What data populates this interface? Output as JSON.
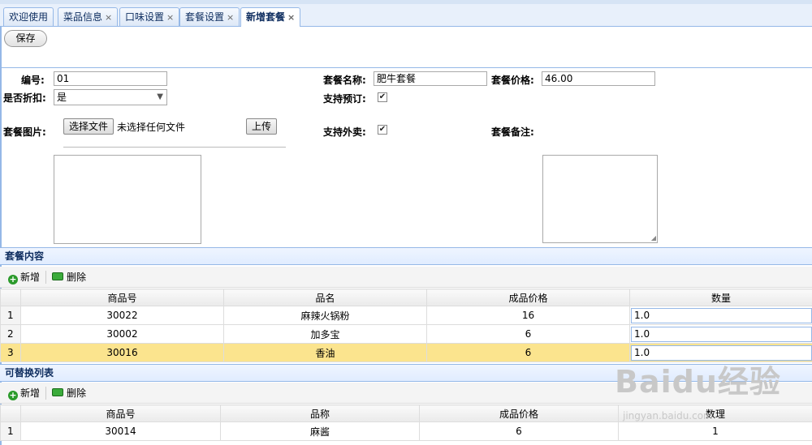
{
  "tabs": [
    {
      "label": "欢迎使用",
      "closable": false
    },
    {
      "label": "菜品信息",
      "closable": true
    },
    {
      "label": "口味设置",
      "closable": true
    },
    {
      "label": "套餐设置",
      "closable": true
    },
    {
      "label": "新增套餐",
      "closable": true,
      "active": true
    }
  ],
  "close_glyph": "×",
  "toolbar": {
    "save_label": "保存"
  },
  "form": {
    "code_label": "编号:",
    "code_value": "01",
    "name_label": "套餐名称:",
    "name_value": "肥牛套餐",
    "price_label": "套餐价格:",
    "price_value": "46.00",
    "discount_label": "是否折扣:",
    "discount_value": "是",
    "reserve_label": "支持预订:",
    "reserve_checked": true,
    "image_label": "套餐图片:",
    "choose_file_label": "选择文件",
    "no_file_text": "未选择任何文件",
    "upload_label": "上传",
    "takeout_label": "支持外卖:",
    "takeout_checked": true,
    "remark_label": "套餐备注:"
  },
  "content_panel": {
    "title": "套餐内容",
    "add_label": "新增",
    "delete_label": "删除",
    "columns": [
      "商品号",
      "品名",
      "成品价格",
      "数量"
    ],
    "rows": [
      {
        "index": "1",
        "code": "30022",
        "name": "麻辣火锅粉",
        "price": "16",
        "qty": "1.0"
      },
      {
        "index": "2",
        "code": "30002",
        "name": "加多宝",
        "price": "6",
        "qty": "1.0"
      },
      {
        "index": "3",
        "code": "30016",
        "name": "香油",
        "price": "6",
        "qty": "1.0"
      }
    ]
  },
  "alt_panel": {
    "title": "可替换列表",
    "add_label": "新增",
    "delete_label": "删除",
    "columns": [
      "商品号",
      "品称",
      "成品价格",
      "数理"
    ],
    "rows": [
      {
        "index": "1",
        "code": "30014",
        "name": "麻酱",
        "price": "6",
        "qty": "1"
      }
    ]
  },
  "watermark": {
    "logo": "Baidu经验",
    "url": "jingyan.baidu.com"
  },
  "colors": {
    "accent_border": "#95b8e7",
    "selected_row": "#fbe48e",
    "panel_title": "#0e2d5f"
  }
}
